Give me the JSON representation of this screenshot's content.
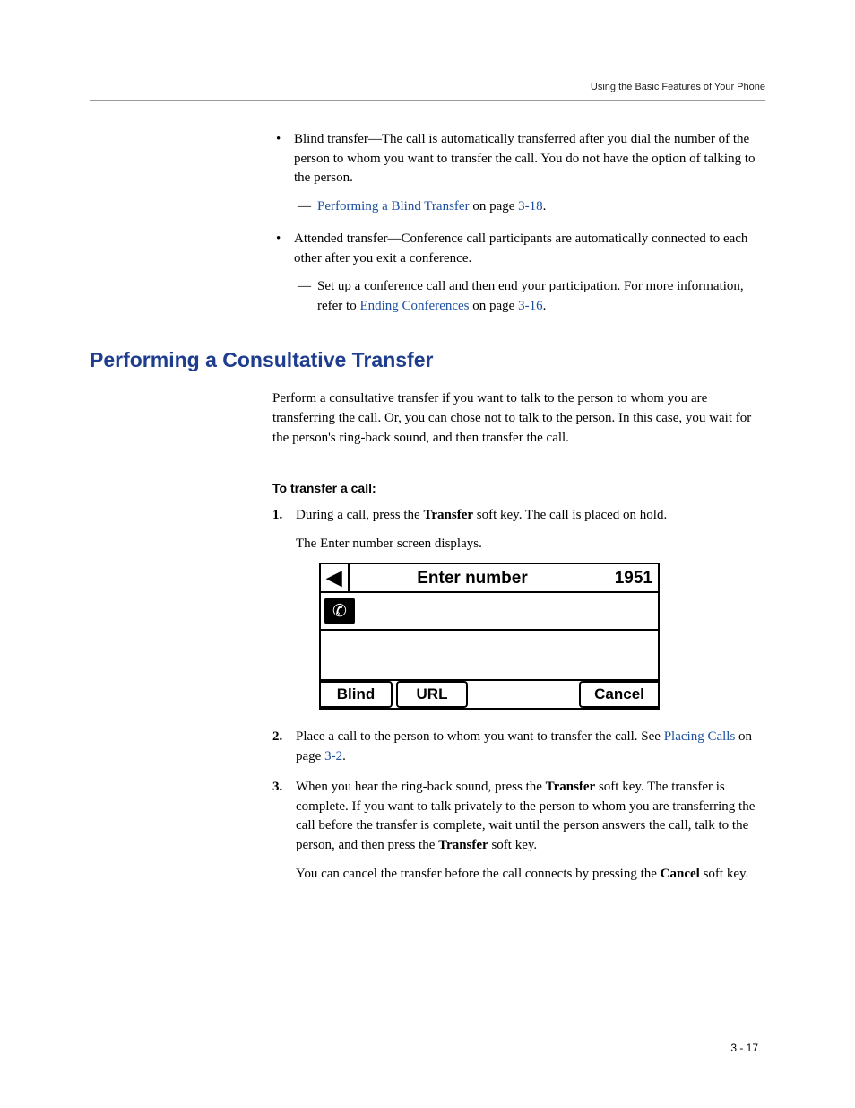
{
  "header": {
    "running": "Using the Basic Features of Your Phone"
  },
  "intro_bullets": {
    "blind": {
      "text": "Blind transfer—The call is automatically transferred after you dial the number of the person to whom you want to transfer the call. You do not have the option of talking to the person.",
      "link_text": "Performing a Blind Transfer",
      "link_suffix_a": " on page ",
      "link_page": "3-18",
      "link_suffix_b": "."
    },
    "attended": {
      "text": "Attended transfer—Conference call participants are automatically connected to each other after you exit a conference.",
      "sub_text_a": "Set up a conference call and then end your participation. For more information, refer to ",
      "sub_link": "Ending Conferences",
      "sub_text_b": " on page ",
      "sub_page": "3-16",
      "sub_text_c": "."
    }
  },
  "section": {
    "title": "Performing a Consultative Transfer",
    "para": "Perform a consultative transfer if you want to talk to the person to whom you are transferring the call. Or, you can chose not to talk to the person. In this case, you wait for the person's ring-back sound, and then transfer the call.",
    "subhead": "To transfer a call:"
  },
  "steps": {
    "s1": {
      "num": "1.",
      "a": "During a call, press the ",
      "key": "Transfer",
      "b": " soft key. The call is placed on hold.",
      "c": "The Enter number screen displays."
    },
    "s2": {
      "num": "2.",
      "a": "Place a call to the person to whom you want to transfer the call. See ",
      "link": "Placing Calls",
      "b": " on page ",
      "page": "3-2",
      "c": "."
    },
    "s3": {
      "num": "3.",
      "a": "When you hear the ring-back sound, press the ",
      "key1": "Transfer",
      "b": " soft key. The transfer is complete. If you want to talk privately to the person to whom you are transferring the call before the transfer is complete, wait until the person answers the call, talk to the person, and then press the ",
      "key2": "Transfer",
      "c": " soft key.",
      "d": "You can cancel the transfer before the call connects by pressing the ",
      "key3": "Cancel",
      "e": " soft key."
    }
  },
  "phone_screen": {
    "back_glyph": "◀",
    "title": "Enter number",
    "extension": "1951",
    "phone_glyph": "✆",
    "softkeys": {
      "blind": "Blind",
      "url": "URL",
      "cancel": "Cancel"
    }
  },
  "footer": {
    "page": "3 - 17"
  }
}
